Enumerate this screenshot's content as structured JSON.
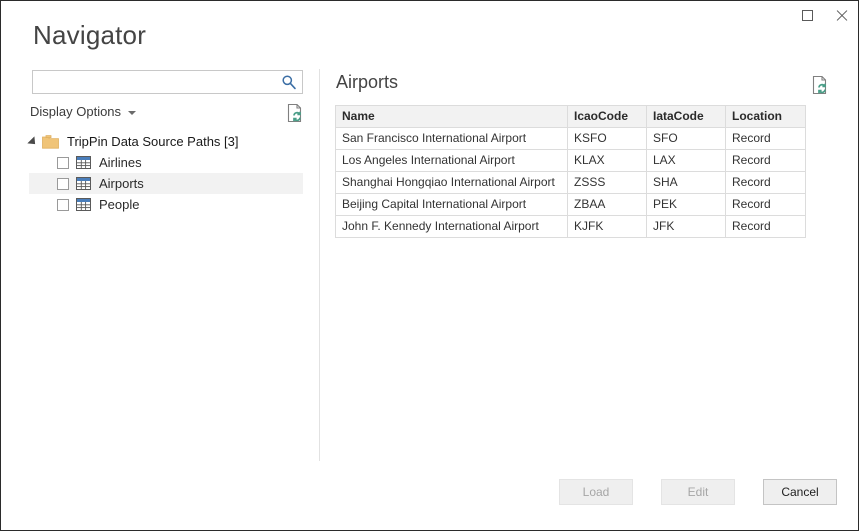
{
  "window": {
    "title": "Navigator",
    "controls": {
      "maximize": "maximize-button",
      "close": "close-button"
    }
  },
  "search": {
    "value": "",
    "placeholder": "",
    "icon": "search-icon"
  },
  "display_options": {
    "label": "Display Options",
    "caret_icon": "chevron-down-icon"
  },
  "refresh_preview": {
    "left_icon": "refresh-document-icon",
    "right_icon": "refresh-document-icon"
  },
  "tree": {
    "root": {
      "label": "TripPin Data Source Paths [3]",
      "expanded": true,
      "icon": "folder-icon"
    },
    "items": [
      {
        "label": "Airlines",
        "checked": false,
        "selected": false,
        "icon": "table-icon"
      },
      {
        "label": "Airports",
        "checked": false,
        "selected": true,
        "icon": "table-icon"
      },
      {
        "label": "People",
        "checked": false,
        "selected": false,
        "icon": "table-icon"
      }
    ]
  },
  "preview": {
    "title": "Airports",
    "columns": [
      "Name",
      "IcaoCode",
      "IataCode",
      "Location"
    ],
    "rows": [
      [
        "San Francisco International Airport",
        "KSFO",
        "SFO",
        "Record"
      ],
      [
        "Los Angeles International Airport",
        "KLAX",
        "LAX",
        "Record"
      ],
      [
        "Shanghai Hongqiao International Airport",
        "ZSSS",
        "SHA",
        "Record"
      ],
      [
        "Beijing Capital International Airport",
        "ZBAA",
        "PEK",
        "Record"
      ],
      [
        "John F. Kennedy International Airport",
        "KJFK",
        "JFK",
        "Record"
      ]
    ]
  },
  "footer": {
    "load_label": "Load",
    "edit_label": "Edit",
    "cancel_label": "Cancel",
    "load_enabled": false,
    "edit_enabled": false,
    "cancel_enabled": true
  },
  "colors": {
    "accent_blue": "#3b6ea5",
    "folder_gold": "#f0c478",
    "table_icon_blue": "#4a7ebb",
    "refresh_green": "#4a9e88",
    "selection_gray": "#f2f2f2",
    "header_gray": "#f2f2f2",
    "border_gray": "#dcdcdc",
    "window_border": "#2b2b2b"
  }
}
